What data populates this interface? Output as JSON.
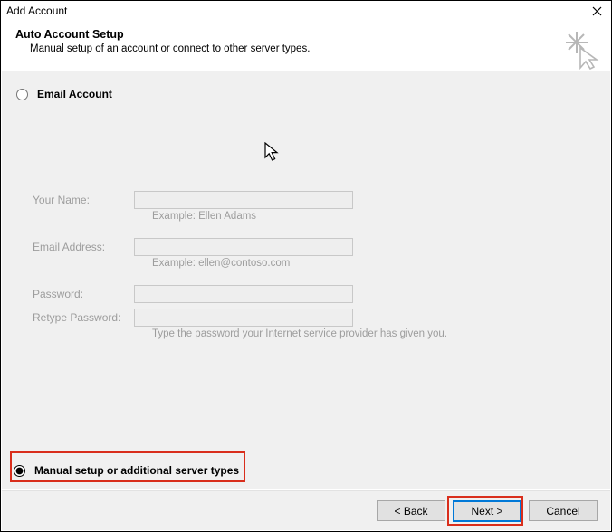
{
  "window": {
    "title": "Add Account"
  },
  "header": {
    "heading": "Auto Account Setup",
    "subheading": "Manual setup of an account or connect to other server types."
  },
  "options": {
    "email_account": {
      "label": "Email Account",
      "selected": false
    },
    "manual_setup": {
      "label": "Manual setup or additional server types",
      "selected": true
    }
  },
  "form": {
    "your_name": {
      "label": "Your Name:",
      "value": "",
      "hint": "Example: Ellen Adams"
    },
    "email": {
      "label": "Email Address:",
      "value": "",
      "hint": "Example: ellen@contoso.com"
    },
    "password": {
      "label": "Password:",
      "value": ""
    },
    "retype": {
      "label": "Retype Password:",
      "value": ""
    },
    "password_help": "Type the password your Internet service provider has given you."
  },
  "footer": {
    "back": "< Back",
    "next": "Next >",
    "cancel": "Cancel"
  }
}
